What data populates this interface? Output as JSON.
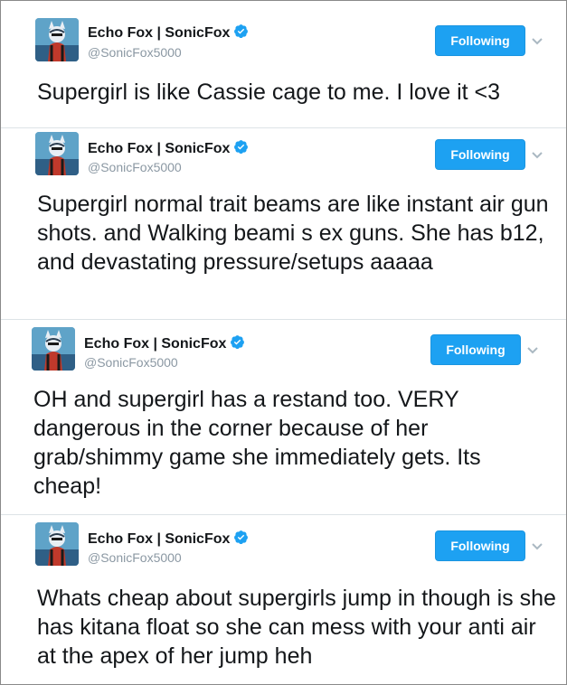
{
  "tweets": [
    {
      "display_name": "Echo Fox | SonicFox",
      "handle": "@SonicFox5000",
      "follow_label": "Following",
      "text": "Supergirl is like Cassie cage to me. I love it <3"
    },
    {
      "display_name": "Echo Fox | SonicFox",
      "handle": "@SonicFox5000",
      "follow_label": "Following",
      "text": "Supergirl normal trait beams are like instant air gun shots. and Walking beami s ex guns. She has b12, and devastating pressure/setups aaaaa"
    },
    {
      "display_name": "Echo Fox | SonicFox",
      "handle": "@SonicFox5000",
      "follow_label": "Following",
      "text": "OH and supergirl has a restand too. VERY dangerous in the corner because of her grab/shimmy game she immediately gets. Its cheap!"
    },
    {
      "display_name": "Echo Fox | SonicFox",
      "handle": "@SonicFox5000",
      "follow_label": "Following",
      "text": "Whats cheap about supergirls jump in though is she has kitana float so she can mess with your anti air at the apex of her jump heh"
    }
  ],
  "colors": {
    "accent": "#1da1f2",
    "verified": "#1da1f2",
    "handle": "#8b98a3",
    "text": "#14171a"
  },
  "icons": {
    "avatar": "avatar-image",
    "verified": "verified-badge-icon",
    "caret": "chevron-down-icon"
  }
}
